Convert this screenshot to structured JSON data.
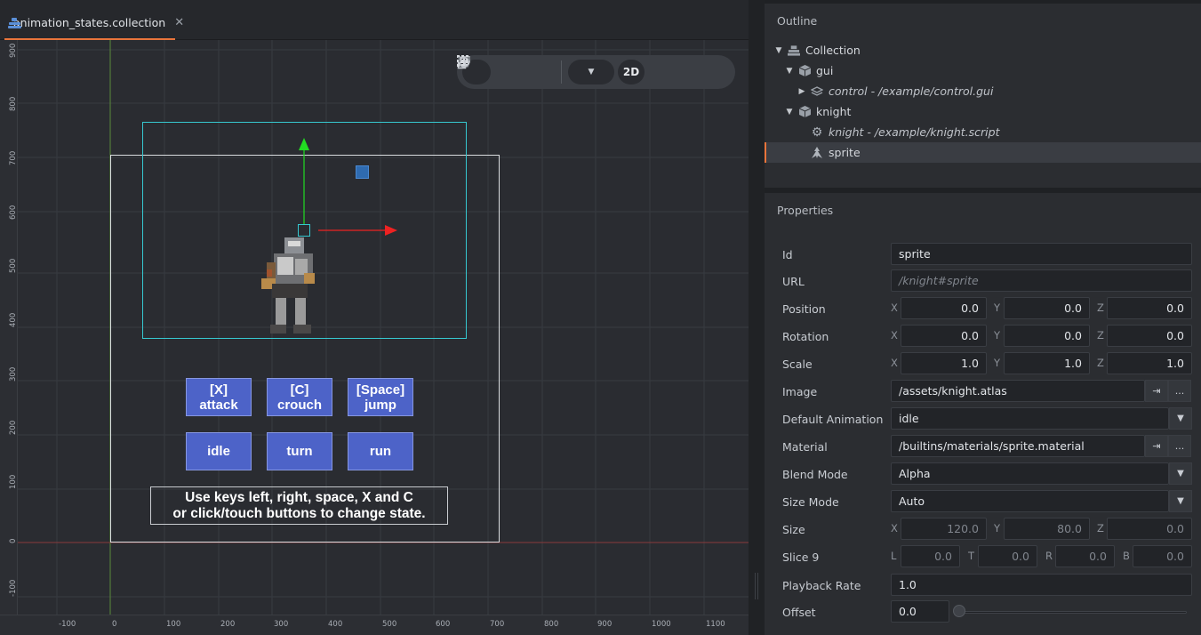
{
  "editor": {
    "tab": {
      "title": "animation_states.collection",
      "close": "✕"
    },
    "toolbar": {
      "tools": [
        "move-icon",
        "rotate-icon",
        "scale-icon"
      ],
      "grid": "grid-icon",
      "mode_2d": "2D",
      "extra": [
        "perspective-icon",
        "reset-camera-icon"
      ]
    },
    "ruler_y": [
      "900",
      "800",
      "700",
      "600",
      "500",
      "400",
      "300",
      "200",
      "100",
      "0",
      "-100"
    ],
    "ruler_x": [
      "-100",
      "0",
      "100",
      "200",
      "300",
      "400",
      "500",
      "600",
      "700",
      "800",
      "900",
      "1000",
      "1100"
    ],
    "game": {
      "buttons_row1": [
        {
          "line1": "[X]",
          "line2": "attack"
        },
        {
          "line1": "[C]",
          "line2": "crouch"
        },
        {
          "line1": "[Space]",
          "line2": "jump"
        }
      ],
      "buttons_row2": [
        "idle",
        "turn",
        "run"
      ],
      "instructions": {
        "line1": "Use keys left, right, space, X and C",
        "line2": "or click/touch buttons to change state."
      }
    }
  },
  "outline": {
    "title": "Outline",
    "items": [
      {
        "label": "Collection",
        "icon": "collection-icon",
        "arrow": "▼",
        "italic": false
      },
      {
        "label": "gui",
        "icon": "game-object-icon",
        "arrow": "▼",
        "italic": false
      },
      {
        "label": "control - /example/control.gui",
        "icon": "gui-icon",
        "arrow": "▶",
        "italic": true
      },
      {
        "label": "knight",
        "icon": "game-object-icon",
        "arrow": "▼",
        "italic": false
      },
      {
        "label": "knight - /example/knight.script",
        "icon": "script-gear-icon",
        "arrow": "",
        "italic": true
      },
      {
        "label": "sprite",
        "icon": "sprite-icon",
        "arrow": "",
        "italic": false
      }
    ]
  },
  "properties": {
    "title": "Properties",
    "id": {
      "label": "Id",
      "value": "sprite"
    },
    "url": {
      "label": "URL",
      "value": "/knight#sprite"
    },
    "position": {
      "label": "Position",
      "x": "0.0",
      "y": "0.0",
      "z": "0.0"
    },
    "rotation": {
      "label": "Rotation",
      "x": "0.0",
      "y": "0.0",
      "z": "0.0"
    },
    "scale": {
      "label": "Scale",
      "x": "1.0",
      "y": "1.0",
      "z": "1.0"
    },
    "image": {
      "label": "Image",
      "value": "/assets/knight.atlas"
    },
    "default_animation": {
      "label": "Default Animation",
      "value": "idle"
    },
    "material": {
      "label": "Material",
      "value": "/builtins/materials/sprite.material"
    },
    "blend_mode": {
      "label": "Blend Mode",
      "value": "Alpha"
    },
    "size_mode": {
      "label": "Size Mode",
      "value": "Auto"
    },
    "size": {
      "label": "Size",
      "x": "120.0",
      "y": "80.0",
      "z": "0.0"
    },
    "slice9": {
      "label": "Slice 9",
      "l": "0.0",
      "t": "0.0",
      "r": "0.0",
      "b": "0.0"
    },
    "playback_rate": {
      "label": "Playback Rate",
      "value": "1.0"
    },
    "offset": {
      "label": "Offset",
      "value": "0.0"
    },
    "axis_labels": {
      "x": "X",
      "y": "Y",
      "z": "Z",
      "l": "L",
      "t": "T",
      "r": "R",
      "b": "B"
    },
    "browse_label": "...",
    "goto_label": "⇥",
    "dropdown_arrow": "▼"
  }
}
